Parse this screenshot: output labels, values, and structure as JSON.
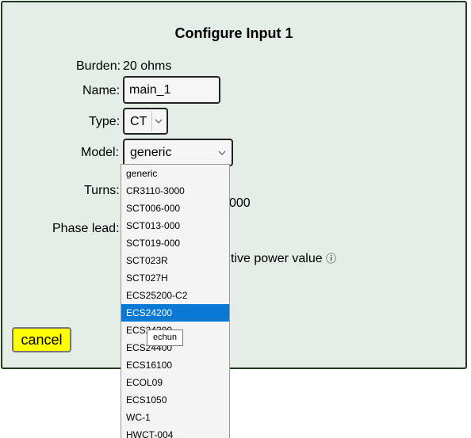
{
  "dialog": {
    "title": "Configure Input 1",
    "burden_label": "Burden:",
    "burden_value": "20 ohms",
    "name_label": "Name:",
    "name_value": "main_1",
    "type_label": "Type:",
    "type_value": "CT",
    "model_label": "Model:",
    "model_value": "generic",
    "turns_label": "Turns:",
    "turns_value_partial": "000",
    "phase_lead_label": "Phase lead:",
    "reverse_power_partial": "tive power value",
    "info_glyph": "ⓘ",
    "cancel_label": "cancel"
  },
  "model_dropdown": {
    "selected": "ECS24200",
    "options": [
      "generic",
      "CR3110-3000",
      "SCT006-000",
      "SCT013-000",
      "SCT019-000",
      "SCT023R",
      "SCT027H",
      "ECS25200-C2",
      "ECS24200",
      "ECS24300",
      "ECS24400",
      "ECS16100",
      "ECOL09",
      "ECS1050",
      "WC-1",
      "HWCT-004"
    ]
  },
  "tooltip": {
    "text": "echun"
  },
  "colors": {
    "dialog_bg": "#e4ede6",
    "cancel_bg": "#ffff00",
    "highlight": "#0a79d6"
  },
  "icons": {
    "type_select": "chevron-down-icon",
    "model_select": "chevron-down-icon"
  }
}
